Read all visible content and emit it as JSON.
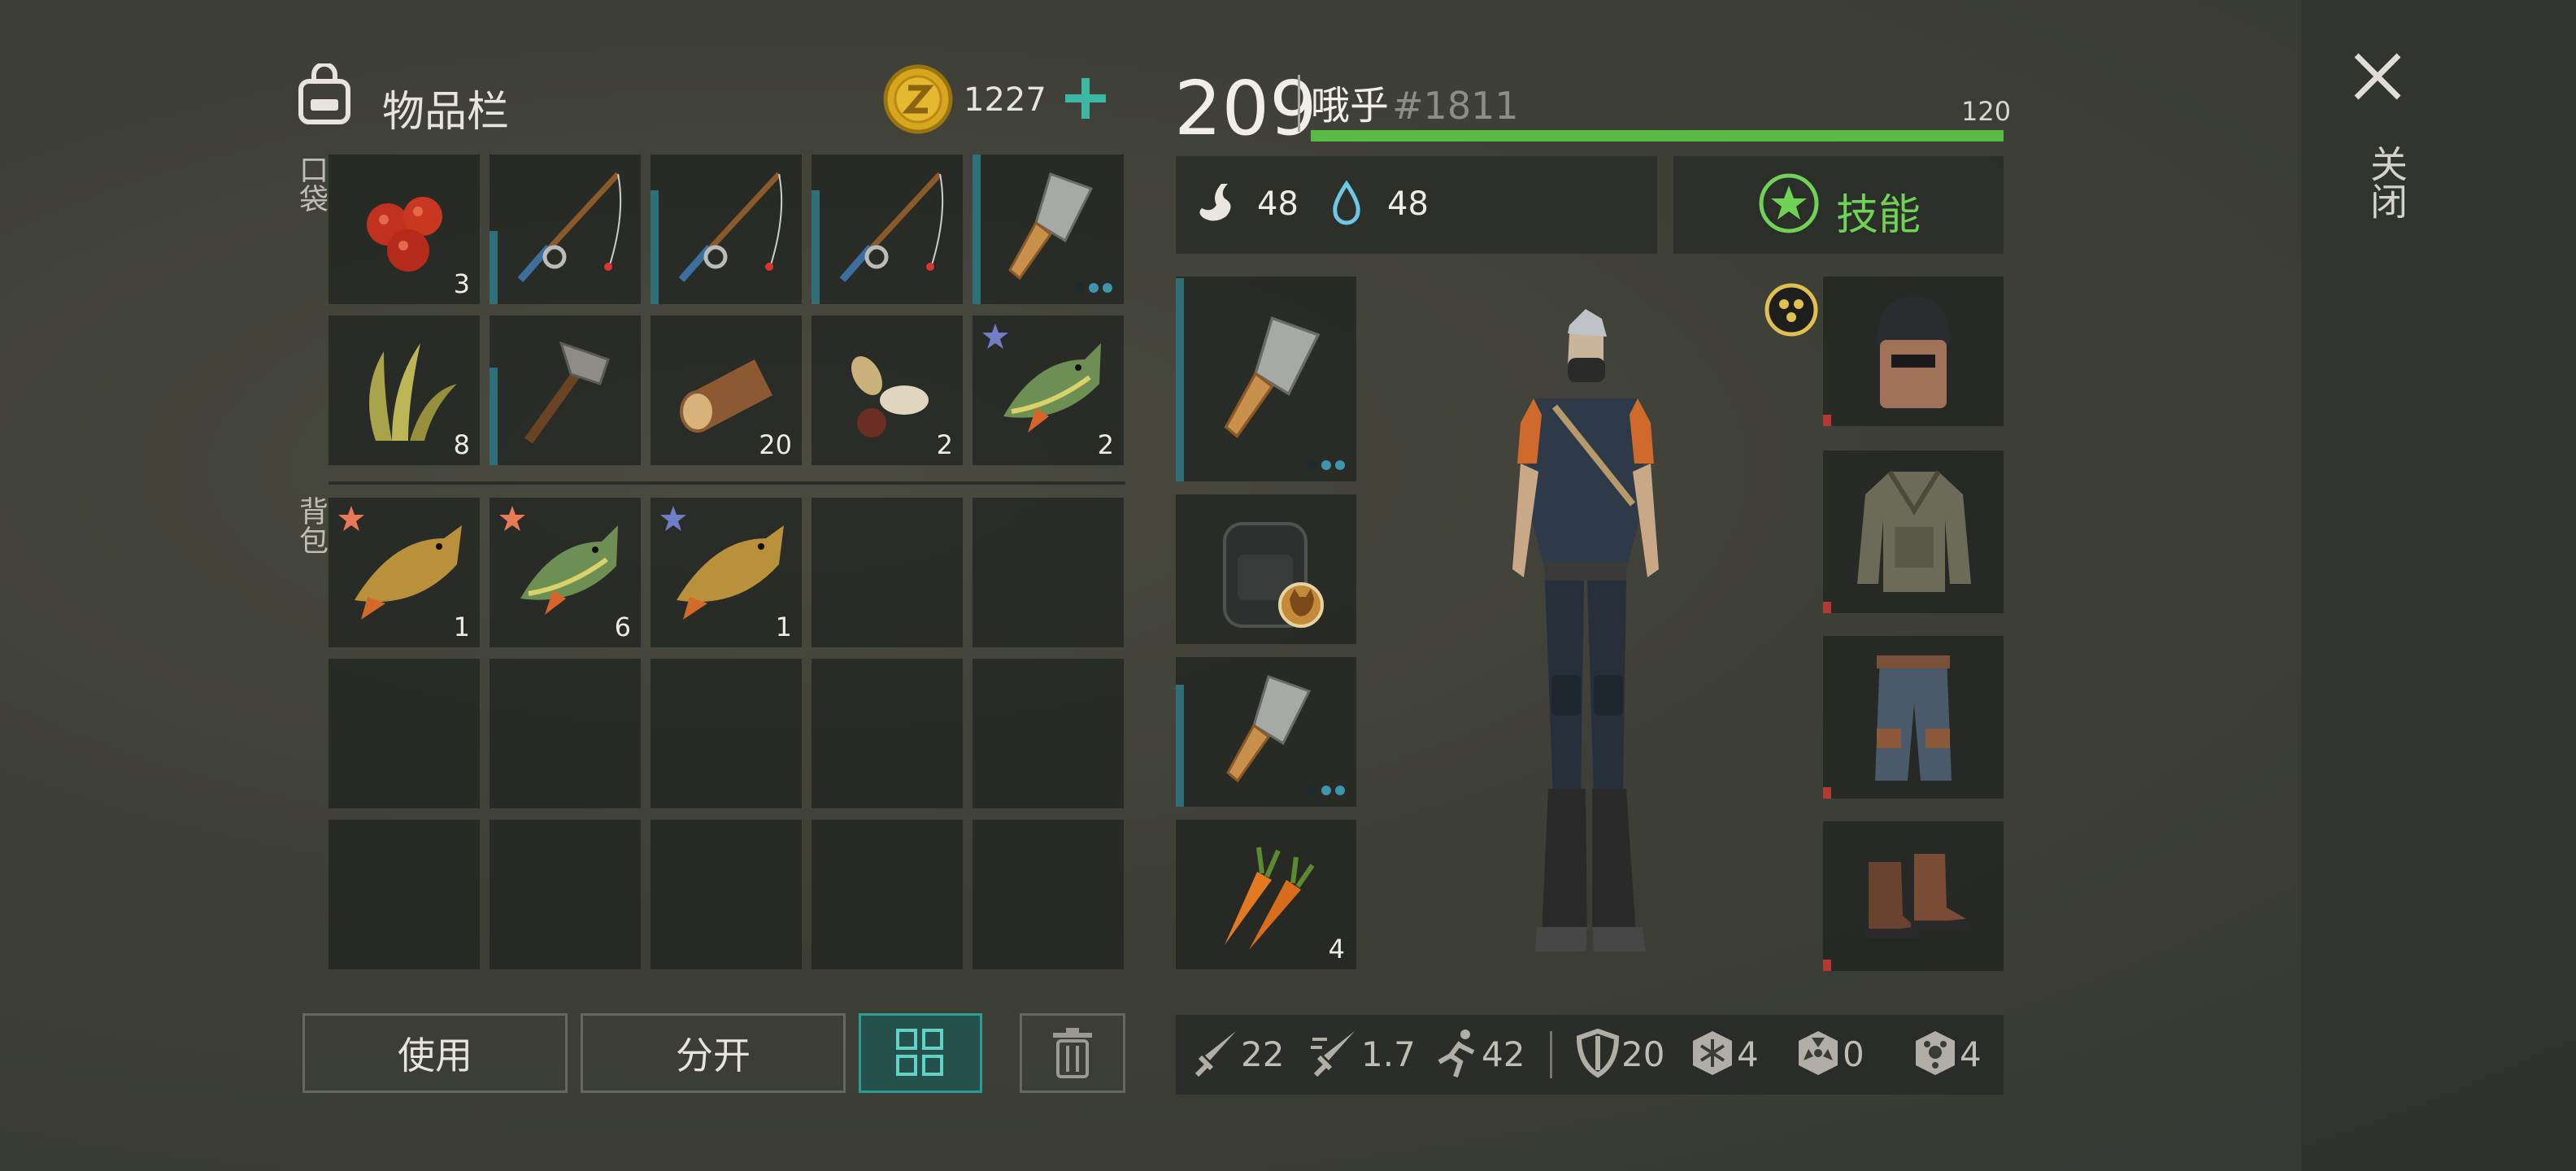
{
  "inventory": {
    "title": "物品栏",
    "pocket_label": "口袋",
    "backpack_label": "背包",
    "coins": "1227",
    "pocket_items": [
      {
        "name": "berries",
        "count": "3"
      },
      {
        "name": "fishing-rod",
        "count": ""
      },
      {
        "name": "fishing-rod",
        "count": ""
      },
      {
        "name": "fishing-rod",
        "count": ""
      },
      {
        "name": "cleaver",
        "count": ""
      },
      {
        "name": "grass",
        "count": "8"
      },
      {
        "name": "stone-hammer",
        "count": ""
      },
      {
        "name": "log",
        "count": "20"
      },
      {
        "name": "seeds",
        "count": "2"
      },
      {
        "name": "perch",
        "count": "2"
      }
    ],
    "backpack_items": [
      {
        "name": "carp",
        "count": "1"
      },
      {
        "name": "perch",
        "count": "6"
      },
      {
        "name": "carp",
        "count": "1"
      }
    ]
  },
  "buttons": {
    "use": "使用",
    "split": "分开"
  },
  "character": {
    "level": "209",
    "name": "哦乎",
    "tag": "#1811",
    "hp_max": "120",
    "hp_fraction": 1.0,
    "hunger": "48",
    "thirst": "48",
    "skills_label": "技能",
    "quick_slot_count": "4"
  },
  "stats": {
    "damage": "22",
    "attack_speed": "1.7",
    "move_speed": "42",
    "armor": "20",
    "cold": "4",
    "radiation": "0",
    "toxic": "4"
  },
  "close_label": "关闭",
  "colors": {
    "hp": "#58bb45",
    "skills": "#6fd155",
    "accent_teal": "#2d9c94",
    "plus": "#3eb6a4"
  }
}
